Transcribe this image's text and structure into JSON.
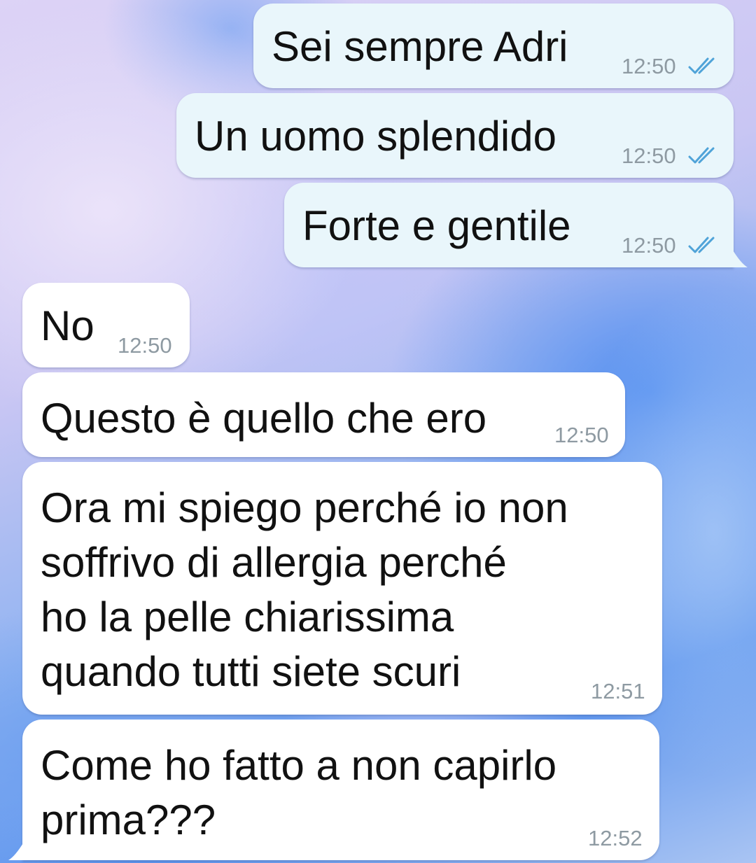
{
  "colors": {
    "outgoing_bubble": "#e9f6fb",
    "incoming_bubble": "#ffffff",
    "timestamp": "#8e9aa2",
    "read_ticks": "#4fa3d8"
  },
  "messages": [
    {
      "direction": "outgoing",
      "text": "Sei sempre Adri",
      "time": "12:50",
      "status_icon": "double-check-read-icon"
    },
    {
      "direction": "outgoing",
      "text": "Un uomo splendido",
      "time": "12:50",
      "status_icon": "double-check-read-icon"
    },
    {
      "direction": "outgoing",
      "text": "Forte e gentile",
      "time": "12:50",
      "status_icon": "double-check-read-icon"
    },
    {
      "direction": "incoming",
      "text": "No",
      "time": "12:50"
    },
    {
      "direction": "incoming",
      "text": "Questo è quello che ero",
      "time": "12:50"
    },
    {
      "direction": "incoming",
      "lines": [
        "Ora mi spiego perché io non",
        "soffrivo di allergia perché",
        "ho la pelle chiarissima",
        "quando tutti siete scuri"
      ],
      "time": "12:51"
    },
    {
      "direction": "incoming",
      "lines": [
        "Come ho fatto a non capirlo",
        "prima???"
      ],
      "time": "12:52"
    }
  ]
}
